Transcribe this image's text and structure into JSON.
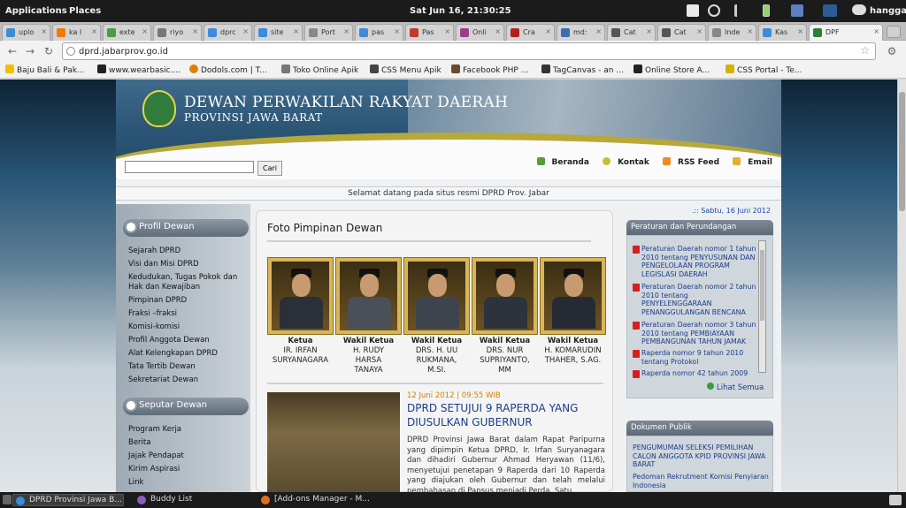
{
  "topbar": {
    "applications": "Applications",
    "places": "Places",
    "clock": "Sat Jun 16, 21:30:25",
    "user": "hangga"
  },
  "tabs": [
    {
      "label": "uplo",
      "color": "#3d8bd9"
    },
    {
      "label": "ka l",
      "color": "#f07b00"
    },
    {
      "label": "exte",
      "color": "#4a9c4a"
    },
    {
      "label": "riyo",
      "color": "#777777"
    },
    {
      "label": "dprc",
      "color": "#3d8bd9"
    },
    {
      "label": "site",
      "color": "#3d8bd9"
    },
    {
      "label": "Port",
      "color": "#888888"
    },
    {
      "label": "pas",
      "color": "#3d8bd9"
    },
    {
      "label": "Pas",
      "color": "#c0392b"
    },
    {
      "label": "Onli",
      "color": "#9b3d8a"
    },
    {
      "label": "Cra",
      "color": "#b02020"
    },
    {
      "label": "md:",
      "color": "#3a6fb0"
    },
    {
      "label": "Cat",
      "color": "#555555"
    },
    {
      "label": "Cat",
      "color": "#555555"
    },
    {
      "label": "Inde",
      "color": "#888888"
    },
    {
      "label": "Kas",
      "color": "#3d8bd9"
    },
    {
      "label": "DPF",
      "color": "#2f7c3b"
    }
  ],
  "address": {
    "url": "dprd.jabarprov.go.id"
  },
  "bookmarks": [
    {
      "label": "Baju Bali & Pak...",
      "color": "#f0c000"
    },
    {
      "label": "www.wearbasic....",
      "color": "#222222"
    },
    {
      "label": "Dodols.com | T...",
      "color": "#e08000"
    },
    {
      "label": "Toko Online Apik",
      "color": "#777777"
    },
    {
      "label": "CSS Menu Apik",
      "color": "#444444"
    },
    {
      "label": "Facebook PHP ...",
      "color": "#6b4a2a"
    },
    {
      "label": "TagCanvas - an ...",
      "color": "#333333"
    },
    {
      "label": "Online Store A...",
      "color": "#222222"
    },
    {
      "label": "CSS Portal - Te...",
      "color": "#d8b000"
    }
  ],
  "site": {
    "title1": "DEWAN PERWAKILAN RAKYAT DAERAH",
    "title2": "PROVINSI JAWA BARAT",
    "nav": {
      "beranda": "Beranda",
      "kontak": "Kontak",
      "rss": "RSS Feed",
      "email": "Email"
    },
    "search_button": "Cari",
    "welcome": "Selamat datang pada situs resmi DPRD Prov. Jabar",
    "date": ".:: Sabtu, 16 Juni 2012",
    "profil_title": "Profil Dewan",
    "profil_items": [
      "Sejarah DPRD",
      "Visi dan Misi DPRD",
      "Kedudukan, Tugas Pokok dan",
      "Hak dan Kewajiban",
      "Pimpinan DPRD",
      "Fraksi –fraksi",
      "Komisi-komisi",
      "Profil Anggota Dewan",
      "Alat Kelengkapan DPRD",
      "Tata Tertib Dewan",
      "Sekretariat Dewan"
    ],
    "seputar_title": "Seputar Dewan",
    "seputar_items": [
      "Program Kerja",
      "Berita",
      "Jajak Pendapat",
      "Kirim Aspirasi",
      "Link"
    ],
    "foto_title": "Foto Pimpinan Dewan",
    "leaders": [
      {
        "role": "Ketua",
        "l1": "IR. IRFAN",
        "l2": "SURYANAGARA",
        "l3": ""
      },
      {
        "role": "Wakil Ketua",
        "l1": "H. RUDY",
        "l2": "HARSA",
        "l3": "TANAYA"
      },
      {
        "role": "Wakil Ketua",
        "l1": "DRS. H. UU",
        "l2": "RUKMANA,",
        "l3": "M.SI."
      },
      {
        "role": "Wakil Ketua",
        "l1": "DRS. NUR",
        "l2": "SUPRIYANTO,",
        "l3": "MM"
      },
      {
        "role": "Wakil Ketua",
        "l1": "H. KOMARUDIN",
        "l2": "THAHER, S.AG.",
        "l3": ""
      }
    ],
    "news": {
      "meta": "12 Juni 2012 | 09:55 WIB",
      "title": "DPRD SETUJUI 9 RAPERDA YANG DIUSULKAN GUBERNUR",
      "body": "DPRD Provinsi Jawa Barat dalam Rapat Paripurna yang dipimpin Ketua DPRD, Ir. Irfan Suryanagara dan dihadiri Gubernur Ahmad Heryawan (11/6), menyetujui penetapan 9 Raperda dari 10 Raperda yang diajukan oleh Gubernur dan telah melalui pembahasan di Pansus menjadi Perda. Satu"
    },
    "peraturan_title": "Peraturan dan Perundangan",
    "peraturan_items": [
      "Peraturan Daerah nomor 1 tahun 2010 tentang PENYUSUNAN DAN PENGELOLAAN PROGRAM LEGISLASI DAERAH",
      "Peraturan Daerah nomor 2 tahun 2010 tentang PENYELENGGARAAN PENANGGULANGAN BENCANA",
      "Peraturan Daerah nomor 3 tahun 2010 tentang PEMBIAYAAN PEMBANGUNAN TAHUN JAMAK",
      "Raperda nomor 9 tahun 2010 tentang Protokol",
      "Raperda nomor 42 tahun 2009"
    ],
    "lihat_semua": "Lihat Semua",
    "dokumen_title": "Dokumen Publik",
    "dokumen_items": [
      "PENGUMUMAN SELEKSI PEMILIHAN CALON ANGGOTA KPID PROVINSI JAWA BARAT",
      "Pedoman Rekrutment Komisi Penyiaran Indonesia"
    ]
  },
  "taskbar": [
    {
      "label": "DPRD Provinsi Jawa B...",
      "color": "#3d8bd9"
    },
    {
      "label": "Buddy List",
      "color": "#8a5cc0"
    },
    {
      "label": "[Add-ons Manager - M...",
      "color": "#e07020"
    }
  ]
}
